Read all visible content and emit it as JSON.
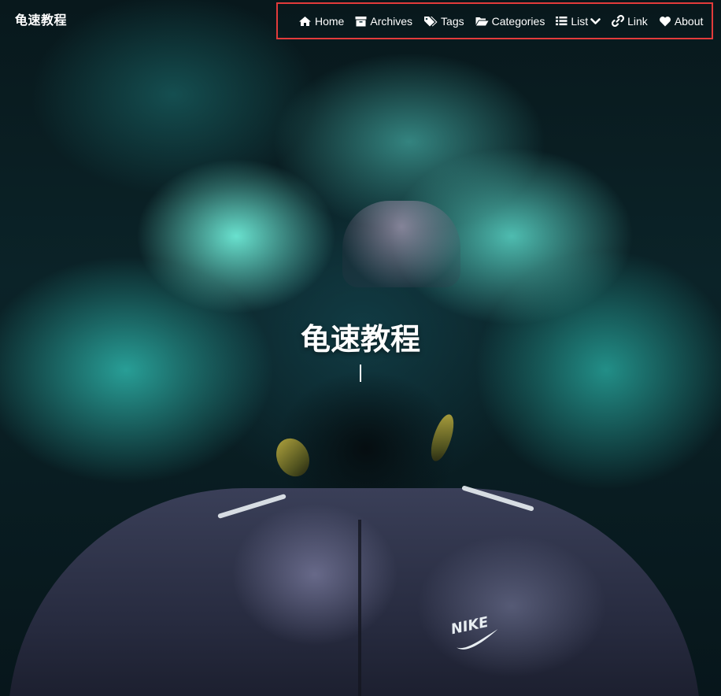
{
  "navbar": {
    "brand": "龟速教程",
    "items": [
      {
        "icon": "home-icon",
        "label": "Home"
      },
      {
        "icon": "archive-icon",
        "label": "Archives"
      },
      {
        "icon": "tags-icon",
        "label": "Tags"
      },
      {
        "icon": "folder-open-icon",
        "label": "Categories"
      },
      {
        "icon": "list-icon",
        "label": "List"
      },
      {
        "icon": "link-icon",
        "label": "Link"
      },
      {
        "icon": "heart-icon",
        "label": "About"
      }
    ]
  },
  "hero": {
    "title": "龟速教程",
    "background": "teal smoke hooded figure photo",
    "logo_text": "NIKE"
  },
  "colors": {
    "highlight_border": "#e23b3b",
    "text": "#ffffff",
    "smoke": "#6eebd7"
  }
}
